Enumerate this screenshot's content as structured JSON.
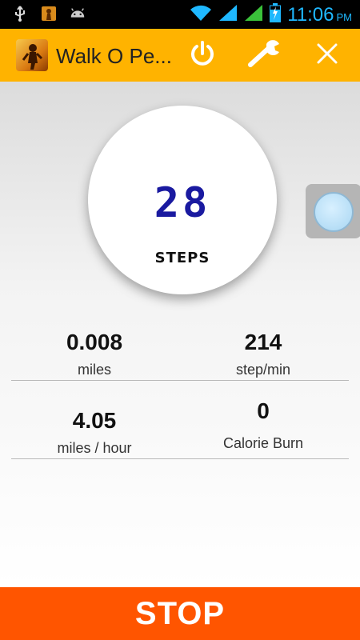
{
  "status_bar": {
    "time": "11:06",
    "ampm": "PM",
    "left_icons": [
      "usb-icon",
      "app-thumbnail-icon",
      "android-icon"
    ],
    "right_icons": [
      "wifi-icon",
      "signal-icon",
      "signal-icon",
      "battery-charging-icon"
    ],
    "accent_color": "#1fb8ff"
  },
  "app_bar": {
    "title": "Walk O Pe...",
    "background": "#ffb300",
    "actions": [
      "power-icon",
      "wrench-icon",
      "close-icon"
    ]
  },
  "counter": {
    "steps": "28",
    "label": "STEPS",
    "digit_color": "#1a1aa0"
  },
  "stats": [
    {
      "value": "0.008",
      "label": "miles"
    },
    {
      "value": "214",
      "label": "step/min"
    },
    {
      "value": "4.05",
      "label": "miles / hour"
    },
    {
      "value": "0",
      "label": "Calorie Burn"
    }
  ],
  "stop_button": {
    "label": "STOP",
    "background": "#ff5500"
  }
}
